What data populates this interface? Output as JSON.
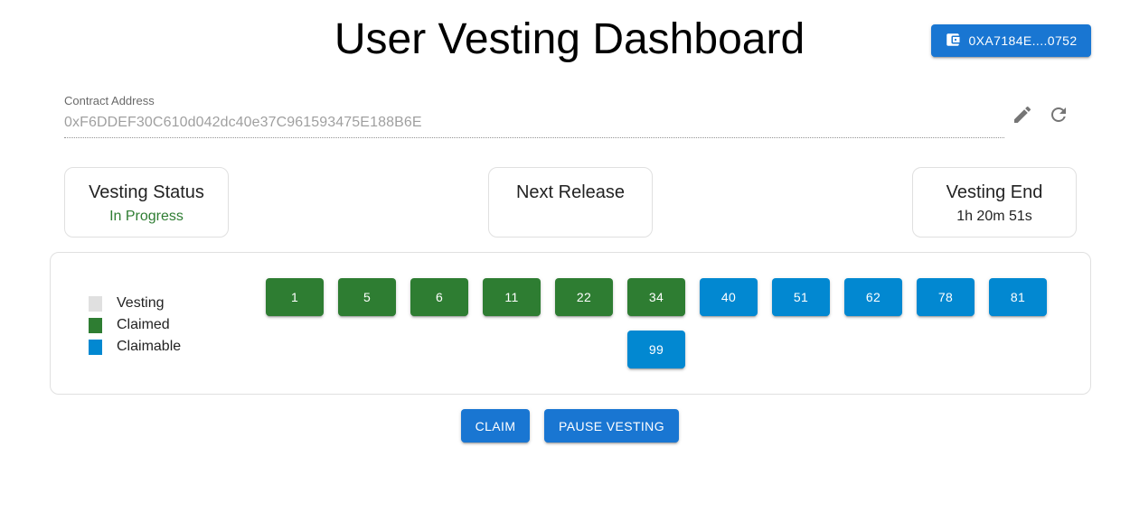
{
  "header": {
    "title": "User Vesting Dashboard",
    "wallet_label": "0XA7184E....0752",
    "wallet_icon": "wallet-icon"
  },
  "contract": {
    "label": "Contract Address",
    "value": "0xF6DDEF30C610d042dc40e37C961593475E188B6E",
    "edit_icon": "pencil-icon",
    "refresh_icon": "refresh-icon"
  },
  "cards": {
    "status": {
      "title": "Vesting Status",
      "value": "In Progress",
      "value_color": "#2e7d32"
    },
    "next_release": {
      "title": "Next Release",
      "value": ""
    },
    "end": {
      "title": "Vesting End",
      "value": "1h 20m 51s"
    }
  },
  "legend": [
    {
      "label": "Vesting",
      "color": "#e0e0e0"
    },
    {
      "label": "Claimed",
      "color": "#2e7d32"
    },
    {
      "label": "Claimable",
      "color": "#0288d1"
    }
  ],
  "schedule": [
    {
      "label": "1",
      "state": "claimed"
    },
    {
      "label": "5",
      "state": "claimed"
    },
    {
      "label": "6",
      "state": "claimed"
    },
    {
      "label": "11",
      "state": "claimed"
    },
    {
      "label": "22",
      "state": "claimed"
    },
    {
      "label": "34",
      "state": "claimed"
    },
    {
      "label": "40",
      "state": "claimable"
    },
    {
      "label": "51",
      "state": "claimable"
    },
    {
      "label": "62",
      "state": "claimable"
    },
    {
      "label": "78",
      "state": "claimable"
    },
    {
      "label": "81",
      "state": "claimable"
    },
    {
      "label": "99",
      "state": "claimable"
    }
  ],
  "actions": {
    "claim_label": "CLAIM",
    "pause_label": "PAUSE VESTING"
  },
  "colors": {
    "primary": "#1976d2",
    "claimed": "#2e7d32",
    "claimable": "#0288d1",
    "vesting": "#e0e0e0"
  }
}
